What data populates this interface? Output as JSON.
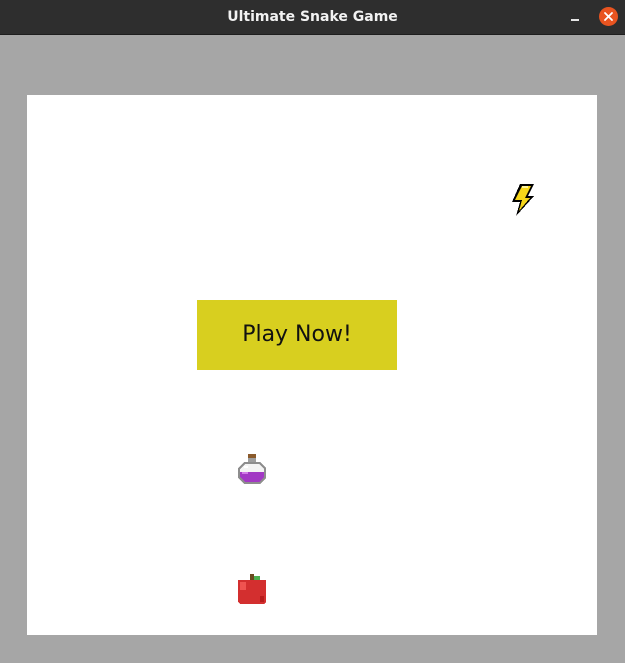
{
  "window": {
    "title": "Ultimate Snake Game",
    "controls": [
      "minimize",
      "close"
    ]
  },
  "game": {
    "play_button_label": "Play Now!",
    "items": [
      {
        "name": "lightning-bolt",
        "icon": "lightning-icon"
      },
      {
        "name": "potion",
        "icon": "potion-icon"
      },
      {
        "name": "apple",
        "icon": "apple-icon"
      }
    ]
  },
  "colors": {
    "titlebar": "#2e2e2e",
    "window_background": "#a6a6a6",
    "game_background": "#ffffff",
    "play_button": "#d8cf1f",
    "close_button": "#e95420"
  }
}
